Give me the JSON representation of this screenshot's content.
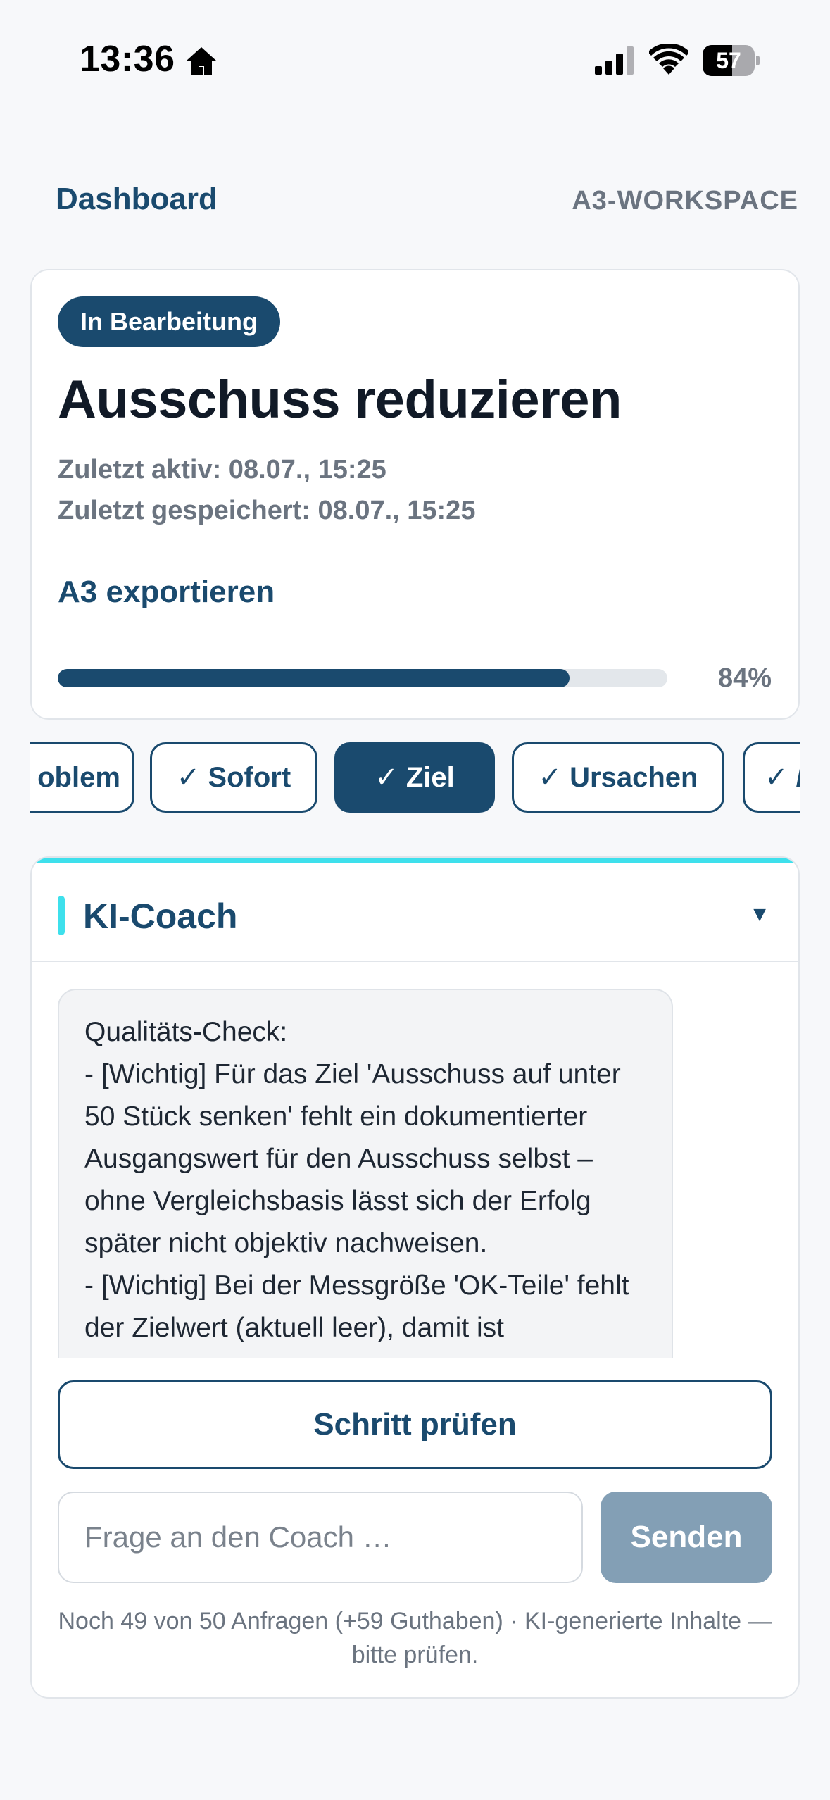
{
  "status_bar": {
    "time": "13:36",
    "battery_level": "57",
    "battery_fraction": 0.57,
    "icons": [
      "home-icon",
      "signal-icon",
      "wifi-icon",
      "battery-icon"
    ]
  },
  "nav": {
    "back_label": "Dashboard",
    "workspace_label": "A3-WORKSPACE"
  },
  "project": {
    "status": "In Bearbeitung",
    "title": "Ausschuss reduzieren",
    "last_active": "Zuletzt aktiv: 08.07., 15:25",
    "last_saved": "Zuletzt gespeichert: 08.07., 15:25",
    "export_label": "A3 exportieren",
    "progress_percent": 84,
    "progress_label": "84%"
  },
  "steps": [
    {
      "label": "oblem",
      "active": false
    },
    {
      "label": "✓ Sofort",
      "active": false
    },
    {
      "label": "✓ Ziel",
      "active": true
    },
    {
      "label": "✓ Ursachen",
      "active": false
    },
    {
      "label": "✓ /",
      "active": false
    }
  ],
  "coach": {
    "title": "KI-Coach",
    "toggle_icon": "▼",
    "message": "Qualitäts-Check:\n- [Wichtig] Für das Ziel 'Ausschuss auf unter 50 Stück senken' fehlt ein dokumentierter Ausgangswert für den Ausschuss selbst – ohne Vergleichsbasis lässt sich der Erfolg später nicht objektiv nachweisen.\n- [Wichtig] Bei der Messgröße 'OK-Teile' fehlt der Zielwert (aktuell leer), damit ist",
    "check_button_label": "Schritt prüfen",
    "input_placeholder": "Frage an den Coach …",
    "input_value": "",
    "send_label": "Senden",
    "quota_note": "Noch 49 von 50 Anfragen (+59 Guthaben) · KI-generierte Inhalte — bitte prüfen."
  },
  "colors": {
    "primary": "#1a4a6e",
    "accent": "#3ee0ec",
    "muted": "#6b7480",
    "disabled_button": "#839fb5",
    "background": "#f7f8fa"
  }
}
